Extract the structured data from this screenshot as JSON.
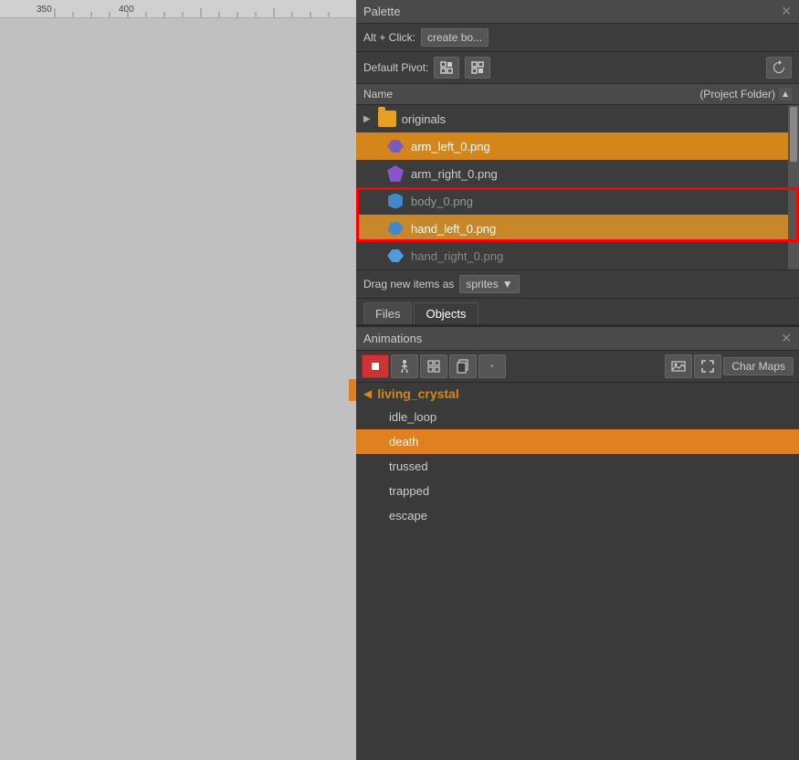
{
  "palette": {
    "title": "Palette",
    "close": "✕",
    "toolbar": {
      "alt_click_label": "Alt + Click:",
      "create_box_btn": "create bo...",
      "default_pivot_label": "Default Pivot:"
    },
    "file_list": {
      "header_name": "Name",
      "header_folder": "(Project Folder)",
      "folder": {
        "name": "originals",
        "expanded": true
      },
      "files": [
        {
          "name": "arm_left_0.png",
          "selected": true,
          "icon": "arm-left"
        },
        {
          "name": "arm_right_0.png",
          "selected": false,
          "icon": "arm-right"
        },
        {
          "name": "body_0.png",
          "selected": false,
          "icon": "body",
          "red_box_start": true
        },
        {
          "name": "hand_left_0.png",
          "selected": true,
          "icon": "hand-left",
          "gold": true,
          "red_box_end": true
        },
        {
          "name": "hand_right_0.png",
          "selected": false,
          "icon": "hand-right",
          "partial": true
        }
      ]
    },
    "drag_label": "Drag new items as",
    "sprites_option": "sprites",
    "tabs": [
      "Files",
      "Objects"
    ]
  },
  "animations": {
    "title": "Animations",
    "close": "✕",
    "char_maps_btn": "Char Maps",
    "group": {
      "name": "living_crystal",
      "items": [
        {
          "name": "idle_loop",
          "selected": false
        },
        {
          "name": "death",
          "selected": true
        },
        {
          "name": "trussed",
          "selected": false
        },
        {
          "name": "trapped",
          "selected": false
        },
        {
          "name": "escape",
          "selected": false
        }
      ]
    }
  },
  "ruler": {
    "marks": [
      "350",
      "400"
    ]
  }
}
